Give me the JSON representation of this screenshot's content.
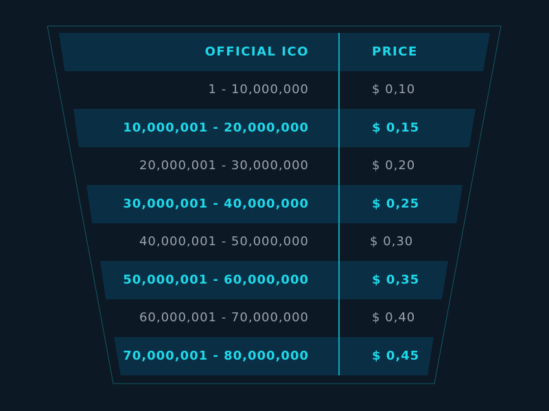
{
  "table": {
    "header": {
      "range_label": "OFFICIAL ICO",
      "price_label": "PRICE"
    },
    "rows": [
      {
        "range": "1 - 10,000,000",
        "price": "$ 0,10",
        "highlighted": false
      },
      {
        "range": "10,000,001 - 20,000,000",
        "price": "$ 0,15",
        "highlighted": true
      },
      {
        "range": "20,000,001 - 30,000,000",
        "price": "$ 0,20",
        "highlighted": false
      },
      {
        "range": "30,000,001 - 40,000,000",
        "price": "$ 0,25",
        "highlighted": true
      },
      {
        "range": "40,000,001 - 50,000,000",
        "price": "$ 0,30",
        "highlighted": false
      },
      {
        "range": "50,000,001 - 60,000,000",
        "price": "$ 0,35",
        "highlighted": true
      },
      {
        "range": "60,000,001 - 70,000,000",
        "price": "$ 0,40",
        "highlighted": false
      },
      {
        "range": "70,000,001 - 80,000,000",
        "price": "$ 0,45",
        "highlighted": true
      }
    ]
  },
  "colors": {
    "background": "#0c1824",
    "band": "#0a2f44",
    "accent": "#1fd8ea",
    "muted_text": "#9aa3ad",
    "divider": "#12a6b8"
  }
}
